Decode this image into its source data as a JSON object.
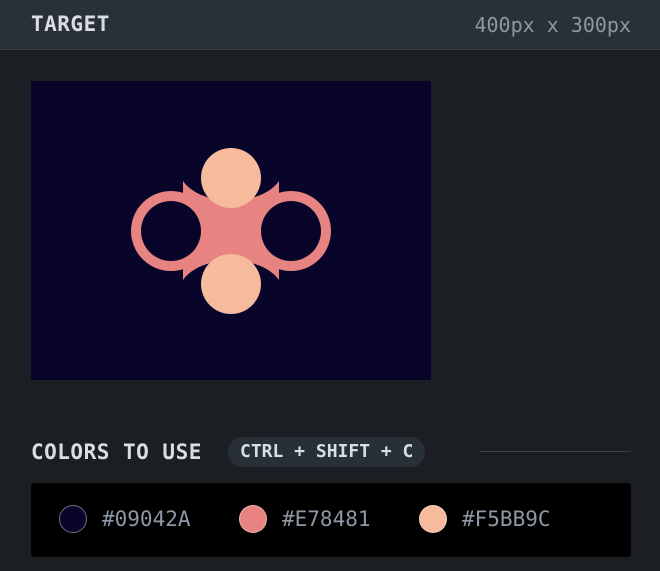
{
  "header": {
    "title": "TARGET",
    "dimensions": "400px x 300px"
  },
  "target": {
    "background": "#09042A",
    "shape_colors": [
      "#E78481",
      "#F5BB9C"
    ],
    "shape_description_icon": "two-rings-and-two-circles"
  },
  "colors_section": {
    "label": "COLORS TO USE",
    "shortcut": "CTRL + SHIFT + C"
  },
  "palette": [
    {
      "hex": "#09042A",
      "color": "#09042A"
    },
    {
      "hex": "#E78481",
      "color": "#E78481"
    },
    {
      "hex": "#F5BB9C",
      "color": "#F5BB9C"
    }
  ]
}
